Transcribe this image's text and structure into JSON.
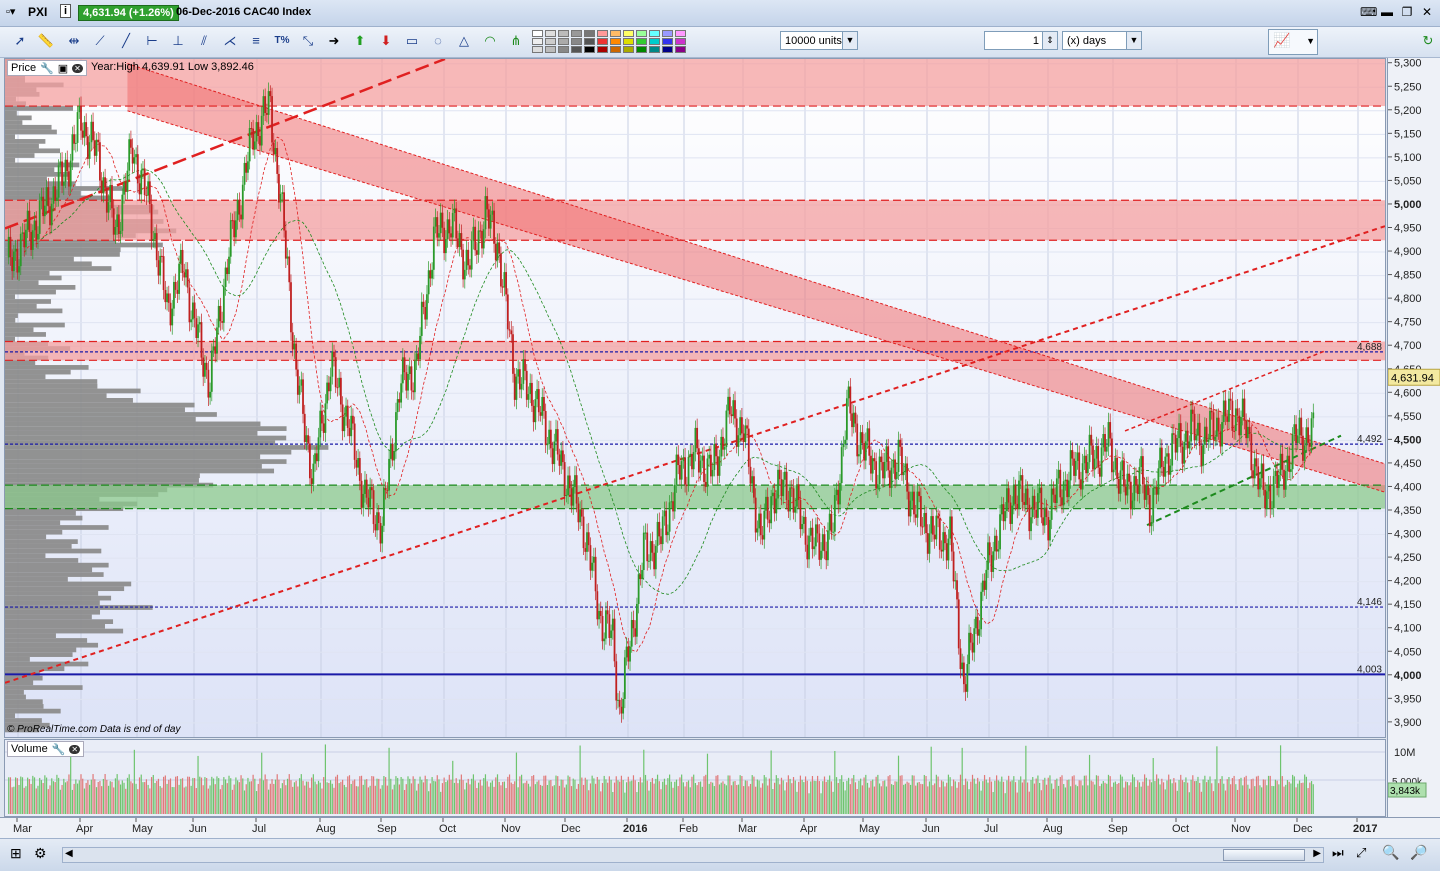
{
  "window": {
    "symbol": "PXI",
    "price_badge": "4,631.94 (+1.26%)",
    "title": "06-Dec-2016 CAC40 Index"
  },
  "toolbar": {
    "units_value": "10000 units",
    "period_value": "1",
    "period_unit": "(x) days"
  },
  "price_panel": {
    "label": "Price",
    "info": "Year:High 4,639.91 Low 3,892.46",
    "footer": "© ProRealTime.com  Data is end of day"
  },
  "volume_panel": {
    "label": "Volume",
    "axis_max": "10M",
    "axis_mid": "5,000k",
    "last_value": "3,843k"
  },
  "markers": {
    "m1": "4,688",
    "m2": "4,492",
    "m3": "4,146",
    "m4": "4,003",
    "last_price": "4,631.94"
  },
  "colors": {
    "resistance_band": "#f4a0a0",
    "support_band": "#8cc98c",
    "up_candle": "#2a9a2a",
    "down_candle": "#c02020",
    "trend_red": "#e02020",
    "trend_green": "#1d8a1d",
    "blue_line": "#1a1aa8",
    "profile": "#8c8c8c"
  },
  "chart_data": {
    "type": "candlestick",
    "title": "CAC40 Index",
    "y_ticks": [
      "5,300",
      "5,250",
      "5,200",
      "5,150",
      "5,100",
      "5,050",
      "5,000",
      "4,950",
      "4,900",
      "4,850",
      "4,800",
      "4,750",
      "4,700",
      "4,650",
      "4,600",
      "4,550",
      "4,500",
      "4,450",
      "4,400",
      "4,350",
      "4,300",
      "4,250",
      "4,200",
      "4,150",
      "4,100",
      "4,050",
      "4,000",
      "3,950",
      "3,900"
    ],
    "ylim": [
      3870,
      5310
    ],
    "x_ticks": [
      "Mar",
      "Apr",
      "May",
      "Jun",
      "Jul",
      "Aug",
      "Sep",
      "Oct",
      "Nov",
      "Dec",
      "2016",
      "Feb",
      "Mar",
      "Apr",
      "May",
      "Jun",
      "Jul",
      "Aug",
      "Sep",
      "Oct",
      "Nov",
      "Dec",
      "2017"
    ],
    "anchors": [
      [
        0,
        4870
      ],
      [
        20,
        4980
      ],
      [
        33,
        5060
      ],
      [
        43,
        5180
      ],
      [
        53,
        5100
      ],
      [
        63,
        4940
      ],
      [
        73,
        5120
      ],
      [
        83,
        4990
      ],
      [
        93,
        4780
      ],
      [
        103,
        4870
      ],
      [
        108,
        4760
      ],
      [
        118,
        4620
      ],
      [
        128,
        4880
      ],
      [
        138,
        5060
      ],
      [
        143,
        5150
      ],
      [
        153,
        5210
      ],
      [
        163,
        4870
      ],
      [
        168,
        4640
      ],
      [
        178,
        4420
      ],
      [
        188,
        4660
      ],
      [
        198,
        4540
      ],
      [
        208,
        4380
      ],
      [
        218,
        4320
      ],
      [
        228,
        4610
      ],
      [
        238,
        4660
      ],
      [
        248,
        4930
      ],
      [
        258,
        4960
      ],
      [
        268,
        4870
      ],
      [
        278,
        4980
      ],
      [
        285,
        4920
      ],
      [
        295,
        4640
      ],
      [
        305,
        4600
      ],
      [
        315,
        4510
      ],
      [
        325,
        4420
      ],
      [
        335,
        4320
      ],
      [
        345,
        4120
      ],
      [
        352,
        4080
      ],
      [
        356,
        3920
      ],
      [
        360,
        4020
      ],
      [
        370,
        4260
      ],
      [
        380,
        4290
      ],
      [
        390,
        4430
      ],
      [
        400,
        4470
      ],
      [
        410,
        4430
      ],
      [
        420,
        4560
      ],
      [
        428,
        4520
      ],
      [
        438,
        4290
      ],
      [
        445,
        4390
      ],
      [
        455,
        4400
      ],
      [
        462,
        4320
      ],
      [
        470,
        4270
      ],
      [
        480,
        4310
      ],
      [
        488,
        4570
      ],
      [
        498,
        4480
      ],
      [
        508,
        4430
      ],
      [
        518,
        4460
      ],
      [
        528,
        4350
      ],
      [
        538,
        4300
      ],
      [
        548,
        4290
      ],
      [
        556,
        3980
      ],
      [
        562,
        4090
      ],
      [
        568,
        4200
      ],
      [
        575,
        4300
      ],
      [
        585,
        4390
      ],
      [
        595,
        4360
      ],
      [
        605,
        4340
      ],
      [
        610,
        4390
      ],
      [
        620,
        4440
      ],
      [
        630,
        4460
      ],
      [
        640,
        4490
      ],
      [
        650,
        4390
      ],
      [
        658,
        4420
      ],
      [
        665,
        4360
      ],
      [
        672,
        4460
      ],
      [
        680,
        4490
      ],
      [
        688,
        4520
      ],
      [
        695,
        4500
      ],
      [
        705,
        4540
      ],
      [
        715,
        4560
      ],
      [
        720,
        4520
      ],
      [
        730,
        4380
      ],
      [
        740,
        4420
      ],
      [
        750,
        4510
      ]
    ],
    "horizontal_lines": [
      {
        "value": 5210,
        "style": "red-dash"
      },
      {
        "value": 5010,
        "style": "red-dash"
      },
      {
        "value": 4925,
        "style": "red-dash"
      },
      {
        "value": 4710,
        "style": "red-dash"
      },
      {
        "value": 4688,
        "style": "blue-dash"
      },
      {
        "value": 4670,
        "style": "red-dash"
      },
      {
        "value": 4492,
        "style": "blue-dash"
      },
      {
        "value": 4405,
        "style": "green-dash"
      },
      {
        "value": 4355,
        "style": "green-dash"
      },
      {
        "value": 4146,
        "style": "blue-dash"
      },
      {
        "value": 4003,
        "style": "blue-solid"
      }
    ],
    "bands": [
      {
        "from": 5210,
        "to": 5310,
        "color": "red"
      },
      {
        "from": 4925,
        "to": 5010,
        "color": "red"
      },
      {
        "from": 4670,
        "to": 4710,
        "color": "red"
      },
      {
        "from": 4355,
        "to": 4405,
        "color": "green"
      }
    ],
    "last_price": 4631.94,
    "volume_max_label": "10M",
    "volume_last_label": "3,843k"
  }
}
